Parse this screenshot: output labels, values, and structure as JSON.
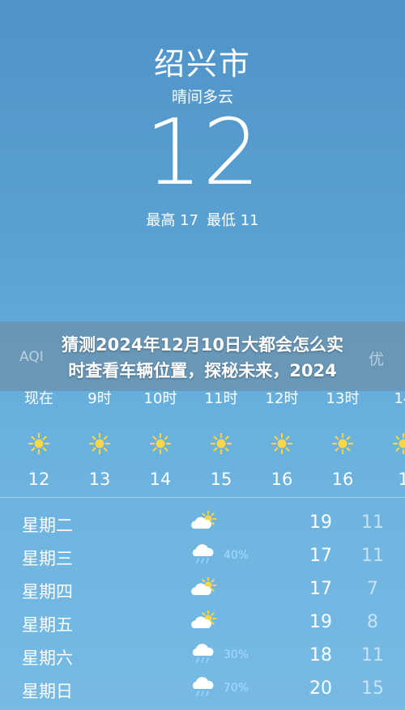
{
  "current": {
    "city": "绍兴市",
    "condition": "晴间多云",
    "temperature": "12",
    "high_label": "最高 17",
    "low_label": "最低 11"
  },
  "headline": {
    "line1": "猜测2024年12月10日大都会怎么实",
    "line2": "时查看车辆位置，探秘未来，2024"
  },
  "aqi": {
    "left_label": "AQI",
    "right_label": "优"
  },
  "hourly": [
    {
      "time": "现在",
      "icon": "sun-icon",
      "temp": "12"
    },
    {
      "time": "9时",
      "icon": "sun-icon",
      "temp": "13"
    },
    {
      "time": "10时",
      "icon": "sun-icon",
      "temp": "14"
    },
    {
      "time": "11时",
      "icon": "sun-icon",
      "temp": "15"
    },
    {
      "time": "12时",
      "icon": "sun-icon",
      "temp": "16"
    },
    {
      "time": "13时",
      "icon": "sun-icon",
      "temp": "16"
    },
    {
      "time": "14",
      "icon": "sun-icon",
      "temp": "1"
    }
  ],
  "daily": [
    {
      "day": "星期二",
      "icon": "partly-cloudy-icon",
      "precip": "",
      "high": "19",
      "low": "11"
    },
    {
      "day": "星期三",
      "icon": "rain-cloud-icon",
      "precip": "40%",
      "high": "17",
      "low": "11"
    },
    {
      "day": "星期四",
      "icon": "partly-cloudy-icon",
      "precip": "",
      "high": "17",
      "low": "7"
    },
    {
      "day": "星期五",
      "icon": "partly-cloudy-icon",
      "precip": "",
      "high": "19",
      "low": "8"
    },
    {
      "day": "星期六",
      "icon": "rain-cloud-icon",
      "precip": "30%",
      "high": "18",
      "low": "11"
    },
    {
      "day": "星期日",
      "icon": "rain-cloud-icon",
      "precip": "70%",
      "high": "20",
      "low": "15"
    }
  ],
  "colors": {
    "sun": "#f7d64a",
    "precip": "#a8dbff"
  }
}
